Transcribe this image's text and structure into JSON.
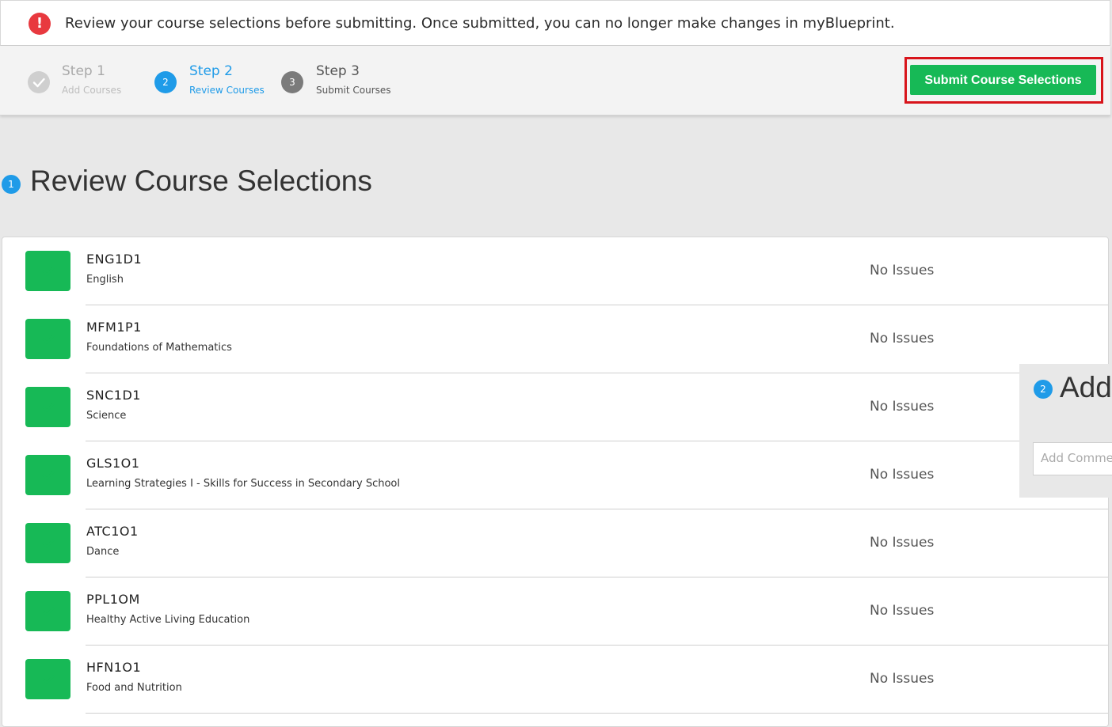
{
  "alert": {
    "icon": "exclamation-icon",
    "text": "Review your course selections before submitting. Once submitted, you can no longer make changes in myBlueprint."
  },
  "steps": [
    {
      "title": "Step 1",
      "subtitle": "Add Courses",
      "state": "complete",
      "icon": "check-icon"
    },
    {
      "title": "Step 2",
      "subtitle": "Review Courses",
      "state": "active",
      "number": "2"
    },
    {
      "title": "Step 3",
      "subtitle": "Submit Courses",
      "state": "pending",
      "number": "3"
    }
  ],
  "submit_button": {
    "label": "Submit Course Selections",
    "color": "#17b956",
    "highlight_color": "#d8141b"
  },
  "review_section": {
    "number": "1",
    "title": "Review Course Selections"
  },
  "courses": [
    {
      "code": "ENG1D1",
      "name": "English",
      "status": "No Issues"
    },
    {
      "code": "MFM1P1",
      "name": "Foundations of Mathematics",
      "status": "No Issues"
    },
    {
      "code": "SNC1D1",
      "name": "Science",
      "status": "No Issues"
    },
    {
      "code": "GLS1O1",
      "name": "Learning Strategies I - Skills for Success in Secondary School",
      "status": "No Issues"
    },
    {
      "code": "ATC1O1",
      "name": "Dance",
      "status": "No Issues"
    },
    {
      "code": "PPL1OM",
      "name": "Healthy Active Living Education",
      "status": "No Issues"
    },
    {
      "code": "HFN1O1",
      "name": "Food and Nutrition",
      "status": "No Issues"
    }
  ],
  "comment_section": {
    "number": "2",
    "title": "Add",
    "input_placeholder": "Add Comme"
  },
  "colors": {
    "accent": "#1f9be8",
    "success": "#17b956",
    "alert": "#e8393f"
  }
}
